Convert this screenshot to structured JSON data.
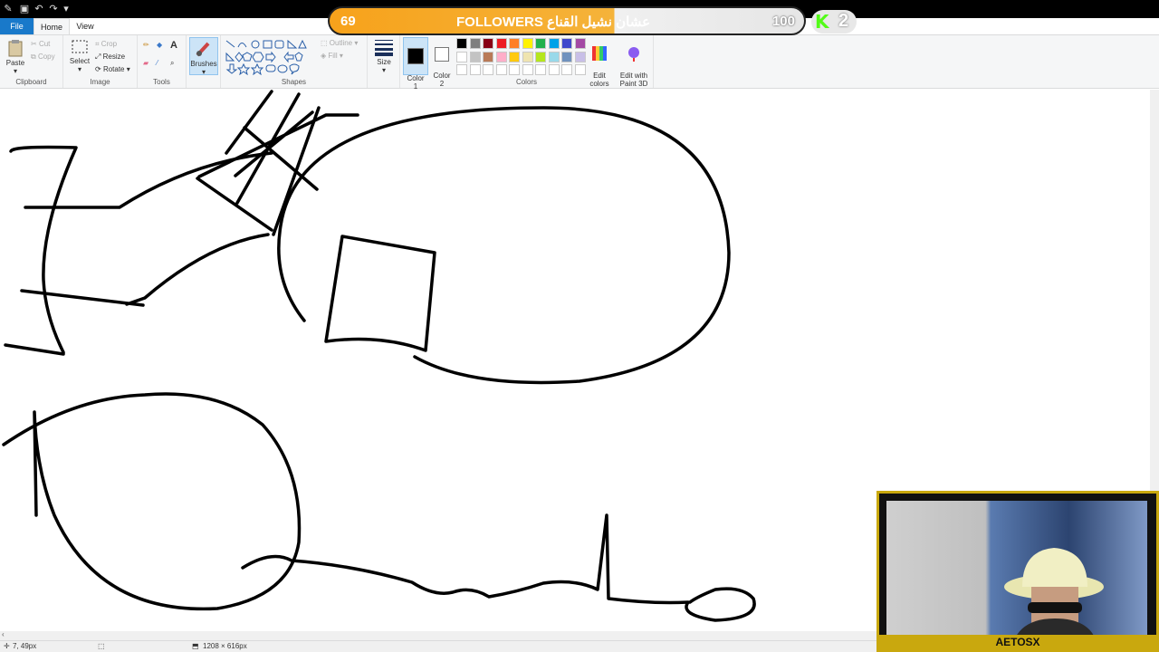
{
  "ribbon": {
    "tabs": [
      "File",
      "Home",
      "View"
    ],
    "clipboard": {
      "paste": "Paste",
      "cut": "Cut",
      "copy": "Copy",
      "label": "Clipboard"
    },
    "image": {
      "select": "Select",
      "crop": "Crop",
      "resize": "Resize",
      "rotate": "Rotate",
      "label": "Image"
    },
    "tools": {
      "label": "Tools"
    },
    "brushes": {
      "label": "Brushes"
    },
    "shapes": {
      "outline": "Outline",
      "fill": "Fill",
      "label": "Shapes"
    },
    "size": {
      "label": "Size"
    },
    "colors": {
      "color1": "Color\n1",
      "color2": "Color\n2",
      "edit_colors": "Edit\ncolors",
      "edit_paint3d": "Edit with\nPaint 3D",
      "label": "Colors",
      "palette_row1": [
        "#000000",
        "#7f7f7f",
        "#880015",
        "#ed1c24",
        "#ff7f27",
        "#fff200",
        "#22b14c",
        "#00a2e8",
        "#3f48cc",
        "#a349a4"
      ],
      "palette_row2": [
        "#ffffff",
        "#c3c3c3",
        "#b97a57",
        "#ffaec9",
        "#ffc90e",
        "#efe4b0",
        "#b5e61d",
        "#99d9ea",
        "#7092be",
        "#c8bfe7"
      ]
    }
  },
  "overlay": {
    "followers_count": "69",
    "title": "FOLLOWERS عشان نشيل القناع",
    "goal": "100",
    "kick_logo": "K",
    "kick_count": "2"
  },
  "statusbar": {
    "cursor_pos": "7, 49px",
    "canvas_size": "1208 × 616px"
  },
  "webcam": {
    "name": "AETOSX"
  }
}
